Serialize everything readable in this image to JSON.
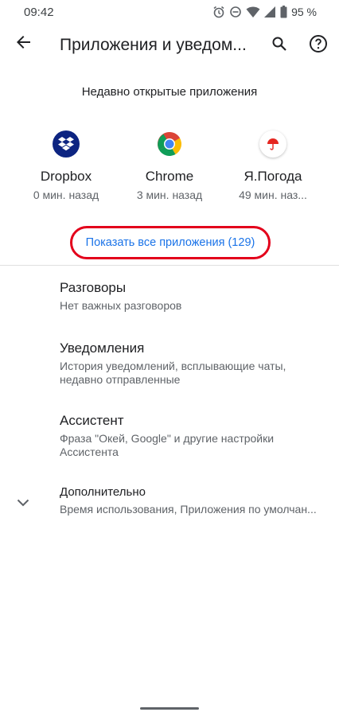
{
  "status_bar": {
    "time": "09:42",
    "battery": "95 %",
    "icons": [
      "alarm-icon",
      "do-not-disturb-icon",
      "wifi-icon",
      "signal-icon",
      "battery-icon"
    ]
  },
  "toolbar": {
    "title": "Приложения и уведом...",
    "back_icon": "arrow-back-icon",
    "search_icon": "search-icon",
    "help_icon": "help-icon"
  },
  "recent": {
    "header": "Недавно открытые приложения",
    "apps": [
      {
        "name": "Dropbox",
        "time": "0 мин. назад",
        "icon": "dropbox-icon"
      },
      {
        "name": "Chrome",
        "time": "3 мин. назад",
        "icon": "chrome-icon"
      },
      {
        "name": "Я.Погода",
        "time": "49 мин. наз...",
        "icon": "yandex-weather-icon"
      }
    ]
  },
  "show_all": {
    "label": "Показать все приложения (129)"
  },
  "settings": {
    "conversations": {
      "title": "Разговоры",
      "summary": "Нет важных разговоров"
    },
    "notifications": {
      "title": "Уведомления",
      "summary": "История уведомлений, всплывающие чаты, недавно отправленные"
    },
    "assistant": {
      "title": "Ассистент",
      "summary": "Фраза \"Окей, Google\" и другие настройки Ассистента"
    },
    "advanced": {
      "title": "Дополнительно",
      "summary": "Время использования, Приложения по умолчан...",
      "icon": "chevron-down-icon"
    }
  },
  "colors": {
    "accent": "#1a73e8",
    "highlight": "#e3001b",
    "dropbox": "#0d2481",
    "text_primary": "#202124",
    "text_secondary": "#5f6368"
  }
}
